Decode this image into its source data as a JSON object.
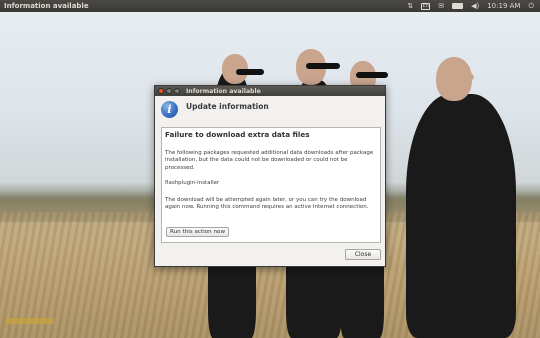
{
  "panel": {
    "app_title": "Information available",
    "keyboard_indicator": "En",
    "time": "10:19 AM"
  },
  "icons": {
    "panel": [
      "network-arrows-icon",
      "keyboard-layout-icon",
      "mail-icon",
      "battery-icon",
      "volume-icon",
      "power-gear-icon"
    ],
    "dialog": "info-icon"
  },
  "dialog": {
    "window_title": "Information available",
    "header_title": "Update information",
    "content_title": "Failure to download extra data files",
    "paragraph1": "The following packages requested additional data downloads after package installation, but the data could not be downloaded or could not be processed.",
    "package": "flashplugin-installer",
    "paragraph2": "The download will be attempted again later, or you can try the download again now.  Running this command requires an active Internet connection.",
    "run_button": "Run this action now",
    "close_button": "Close"
  },
  "colors": {
    "panel_bg": "#3b3a36",
    "close_button_accent": "#e05e2b",
    "info_icon_blue": "#3a6fc3"
  }
}
